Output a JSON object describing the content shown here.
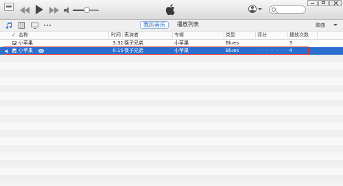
{
  "player": {
    "volume_level": 0.55
  },
  "search": {
    "placeholder": "",
    "value": ""
  },
  "nav": {
    "tabs": [
      {
        "label": "我的音乐",
        "active": true
      },
      {
        "label": "播放列表",
        "active": false
      }
    ],
    "view_label": "歌曲"
  },
  "table": {
    "headers": {
      "check": "✓",
      "name": "名称",
      "time": "时间",
      "artist": "表演者",
      "album": "专辑",
      "genre": "类型",
      "rating": "评分",
      "plays": "播放次数"
    },
    "rows": [
      {
        "name": "小苹果",
        "time": "3:31",
        "artist": "筷子兄弟",
        "album": "小苹果",
        "genre": "Blues",
        "rating": "",
        "plays": "3",
        "selected": false,
        "playing": false
      },
      {
        "name": "小苹果",
        "time": "0:15",
        "artist": "筷子兄弟",
        "album": "小苹果",
        "genre": "Blues",
        "rating": "· · · · ·",
        "plays": "4",
        "selected": true,
        "playing": true
      }
    ]
  },
  "colors": {
    "accent": "#1a5fb4",
    "selection": "#2a6fd0",
    "highlight_box": "#e0332f"
  }
}
